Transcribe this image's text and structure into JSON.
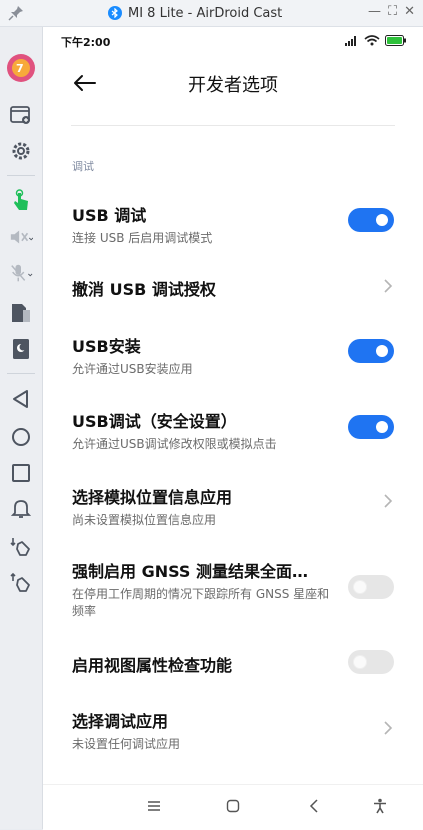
{
  "window": {
    "title": "MI 8 Lite - AirDroid Cast",
    "controls": [
      "—",
      "⛶",
      "✕"
    ]
  },
  "status_bar": {
    "time": "下午2:00"
  },
  "header": {
    "title": "开发者选项"
  },
  "section_label": "调试",
  "rows": [
    {
      "title": "USB 调试",
      "subtitle": "连接 USB 后启用调试模式",
      "control": "toggle",
      "state": "on"
    },
    {
      "title": "撤消 USB 调试授权",
      "subtitle": "",
      "control": "chevron"
    },
    {
      "title": "USB安装",
      "subtitle": "允许通过USB安装应用",
      "control": "toggle",
      "state": "on"
    },
    {
      "title": "USB调试（安全设置）",
      "subtitle": "允许通过USB调试修改权限或模拟点击",
      "control": "toggle",
      "state": "on"
    },
    {
      "title": "选择模拟位置信息应用",
      "subtitle": "尚未设置模拟位置信息应用",
      "control": "chevron"
    },
    {
      "title": "强制启用 GNSS 测量结果全面…",
      "subtitle": "在停用工作周期的情况下跟踪所有 GNSS 星座和频率",
      "control": "toggle",
      "state": "off"
    },
    {
      "title": "启用视图属性检查功能",
      "subtitle": "",
      "control": "toggle",
      "state": "off"
    },
    {
      "title": "选择调试应用",
      "subtitle": "未设置任何调试应用",
      "control": "chevron"
    }
  ],
  "colors": {
    "accent": "#1f74f2",
    "toggle_off": "#e6e6e6",
    "section_label": "#7f8aa0"
  },
  "sidebar_icons": [
    "avatar",
    "screenshot-icon",
    "gear-icon",
    "touch-control-icon",
    "speaker-muted-icon",
    "mic-muted-icon",
    "file-transfer-icon",
    "theme-icon",
    "back-triangle-icon",
    "home-circle-icon",
    "recents-square-icon",
    "bell-icon",
    "volume-down-icon",
    "volume-up-icon"
  ],
  "nav_icons": [
    "menu-icon",
    "home-icon",
    "back-icon",
    "accessibility-icon"
  ]
}
